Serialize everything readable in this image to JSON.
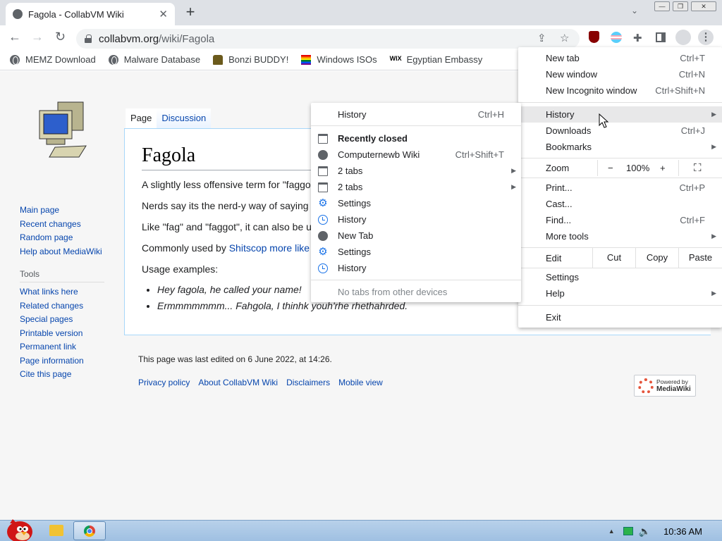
{
  "browser": {
    "tab_title": "Fagola - CollabVM Wiki",
    "url_host": "collabvm.org",
    "url_path": "/wiki/Fagola"
  },
  "bookmarks": [
    {
      "label": "MEMZ Download",
      "icon": "globe-icon"
    },
    {
      "label": "Malware Database",
      "icon": "globe-icon"
    },
    {
      "label": "Bonzi BUDDY!",
      "icon": "bonzi-icon"
    },
    {
      "label": "Windows ISOs",
      "icon": "rainbow-flag-icon"
    },
    {
      "label": "Egyptian Embassy",
      "icon": "wix-icon"
    }
  ],
  "wiki": {
    "tab_page": "Page",
    "tab_discussion": "Discussion",
    "heading": "Fagola",
    "p1": "A slightly less offensive term for \"faggo",
    "p2": "Nerds say its the nerd-y way of saying",
    "p3": "Like \"fag\" and \"faggot\", it can also be u",
    "p4_prefix": "Commonly used by ",
    "p4_link": "Shitscop more like",
    "p5": "Usage examples:",
    "examples": [
      "Hey fagola, he called your name!",
      "Ermmmmmmm... Fahgola, I thinhk youh'rhe rhethahrded."
    ],
    "nav": [
      "Main page",
      "Recent changes",
      "Random page",
      "Help about MediaWiki"
    ],
    "tools_heading": "Tools",
    "tools": [
      "What links here",
      "Related changes",
      "Special pages",
      "Printable version",
      "Permanent link",
      "Page information",
      "Cite this page"
    ],
    "last_edited": "This page was last edited on 6 June 2022, at 14:26.",
    "footer_links": [
      "Privacy policy",
      "About CollabVM Wiki",
      "Disclaimers",
      "Mobile view"
    ],
    "powered_line1": "Powered by",
    "powered_line2": "MediaWiki"
  },
  "main_menu": {
    "new_tab": "New tab",
    "new_tab_sc": "Ctrl+T",
    "new_window": "New window",
    "new_window_sc": "Ctrl+N",
    "incognito": "New Incognito window",
    "incognito_sc": "Ctrl+Shift+N",
    "history": "History",
    "downloads": "Downloads",
    "downloads_sc": "Ctrl+J",
    "bookmarks": "Bookmarks",
    "zoom": "Zoom",
    "zoom_minus": "−",
    "zoom_level": "100%",
    "zoom_plus": "+",
    "print": "Print...",
    "print_sc": "Ctrl+P",
    "cast": "Cast...",
    "find": "Find...",
    "find_sc": "Ctrl+F",
    "more_tools": "More tools",
    "edit": "Edit",
    "cut": "Cut",
    "copy": "Copy",
    "paste": "Paste",
    "settings": "Settings",
    "help": "Help",
    "exit": "Exit"
  },
  "history_menu": {
    "history": "History",
    "history_sc": "Ctrl+H",
    "recently_closed": "Recently closed",
    "items": [
      {
        "label": "Computernewb Wiki",
        "sc": "Ctrl+Shift+T",
        "icon": "site-icon"
      },
      {
        "label": "2 tabs",
        "icon": "window-icon"
      },
      {
        "label": "2 tabs",
        "icon": "window-icon"
      },
      {
        "label": "Settings",
        "icon": "gear-icon"
      },
      {
        "label": "History",
        "icon": "history-icon"
      },
      {
        "label": "New Tab",
        "icon": "globe-icon"
      },
      {
        "label": "Settings",
        "icon": "gear-icon"
      },
      {
        "label": "History",
        "icon": "history-icon"
      }
    ],
    "no_other_devices": "No tabs from other devices"
  },
  "taskbar": {
    "clock": "10:36 AM"
  },
  "colors": {
    "link": "#0645ad",
    "accent": "#1a73e8",
    "taskbar": "#b8d1ea"
  }
}
